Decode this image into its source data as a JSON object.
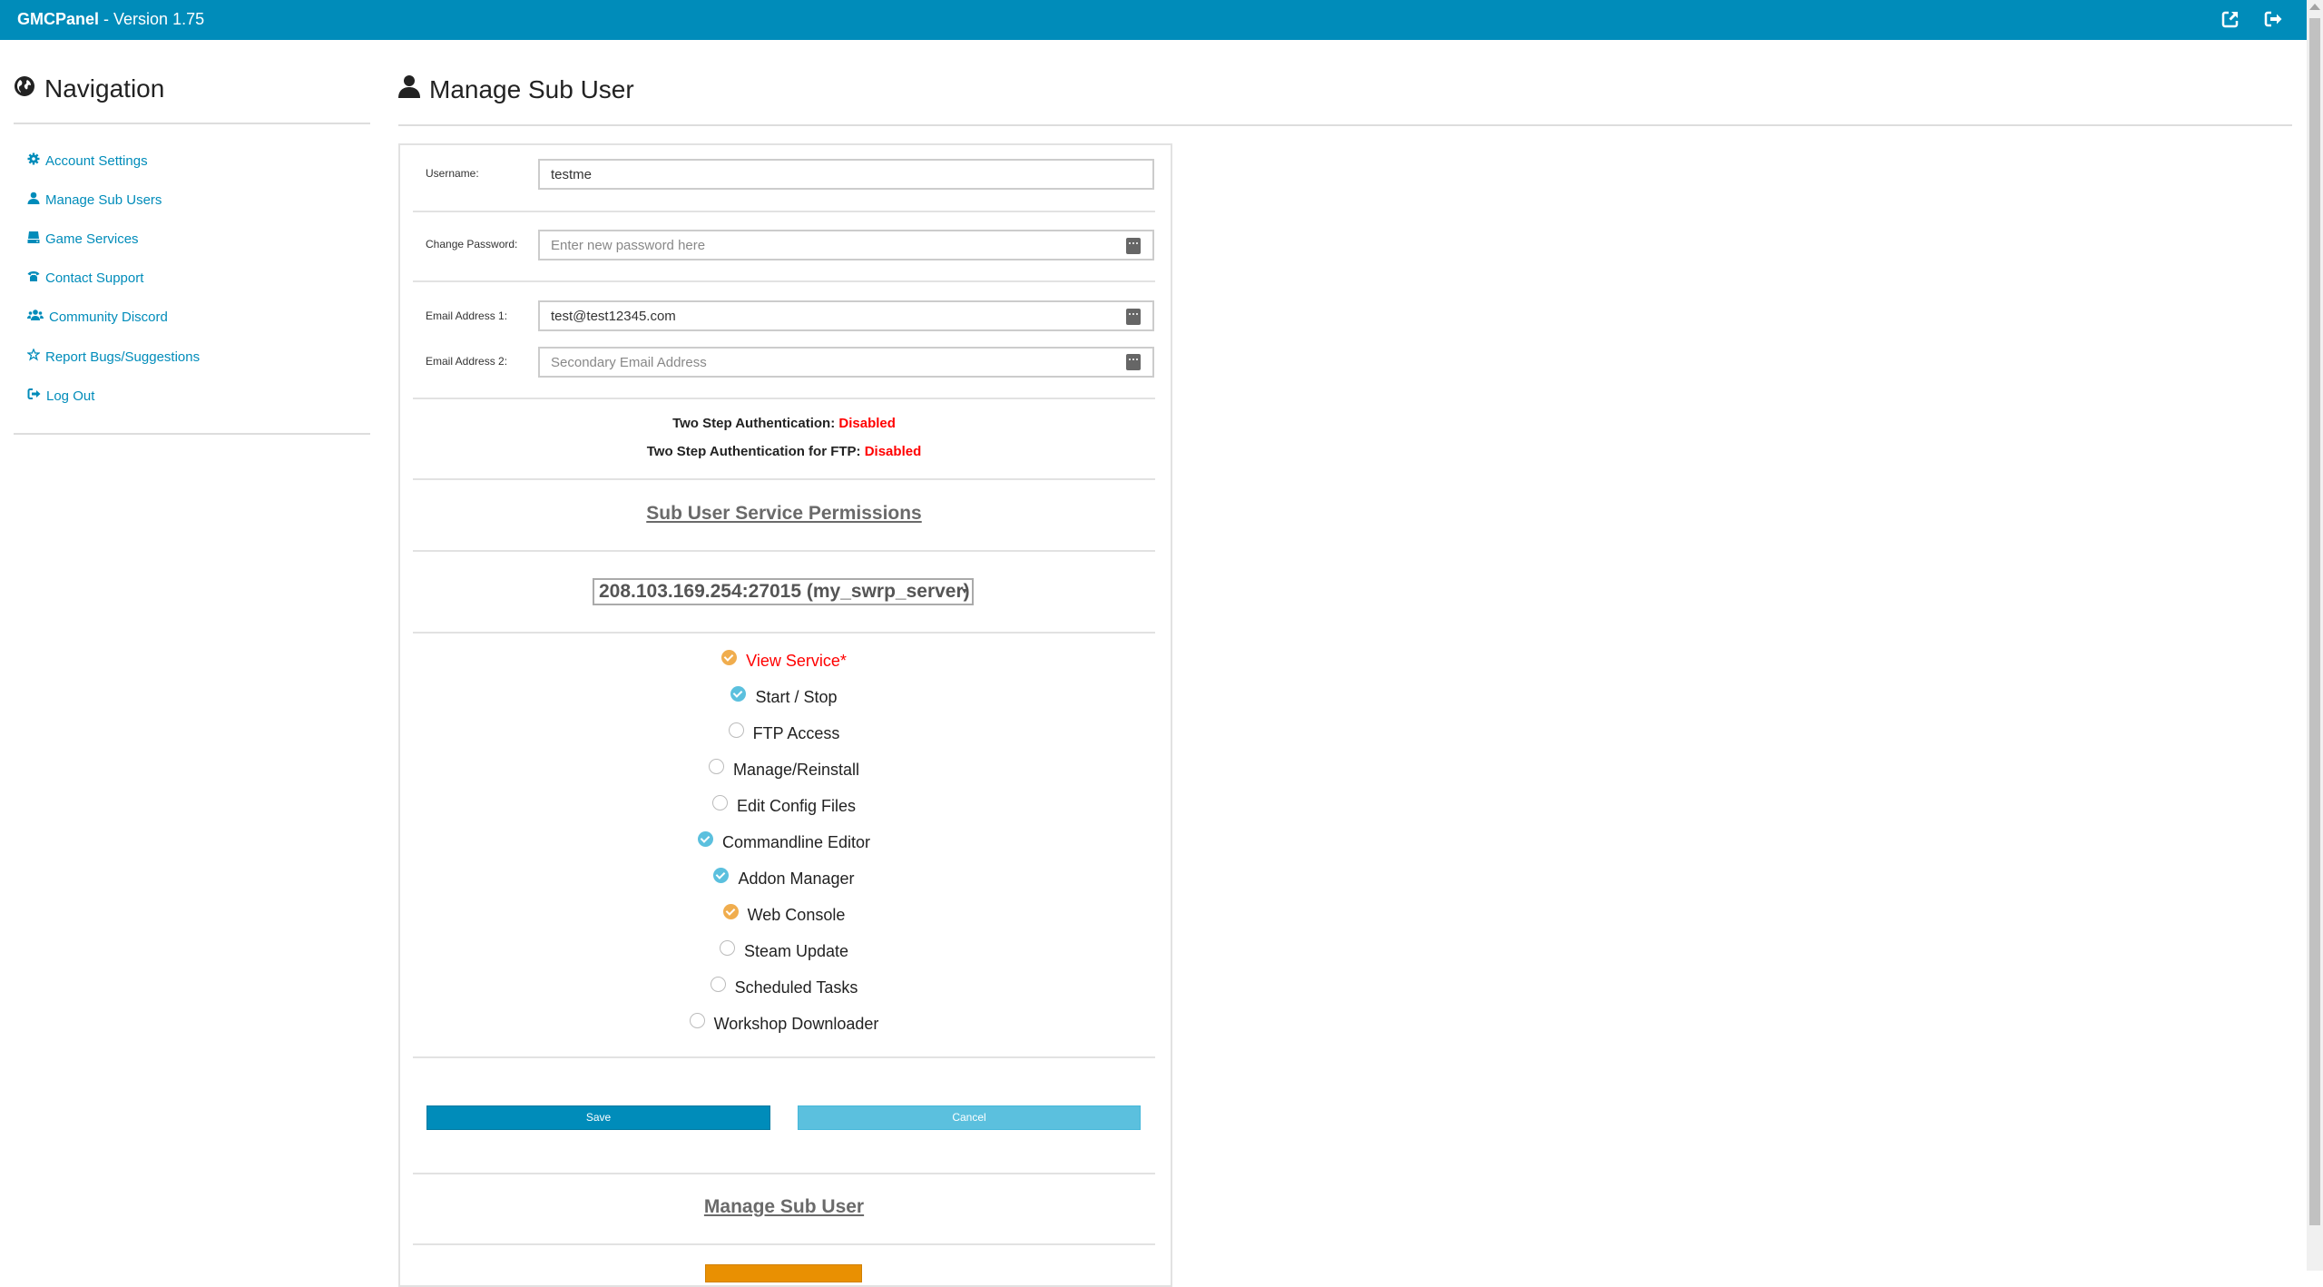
{
  "header": {
    "brand": "GMCPanel",
    "version": " - Version 1.75",
    "icons": [
      "external-link-icon",
      "sign-out-icon"
    ],
    "color": "#008cba"
  },
  "sidebar": {
    "title": "Navigation",
    "items": [
      {
        "label": "Account Settings",
        "icon": "gear-icon"
      },
      {
        "label": "Manage Sub Users",
        "icon": "user-icon"
      },
      {
        "label": "Game Services",
        "icon": "hdd-icon"
      },
      {
        "label": "Contact Support",
        "icon": "phone-icon"
      },
      {
        "label": "Community Discord",
        "icon": "users-icon"
      },
      {
        "label": "Report Bugs/Suggestions",
        "icon": "star-icon"
      },
      {
        "label": "Log Out",
        "icon": "sign-out-icon"
      }
    ]
  },
  "main": {
    "title": "Manage Sub User",
    "form": {
      "username_label": "Username:",
      "username_value": "testme",
      "password_label": "Change Password:",
      "password_placeholder": "Enter new password here",
      "email1_label": "Email Address 1:",
      "email1_value": "test@test12345.com",
      "email2_label": "Email Address 2:",
      "email2_placeholder": "Secondary Email Address"
    },
    "two_step": {
      "label": "Two Step Authentication: ",
      "status": "Disabled",
      "ftp_label": "Two Step Authentication for FTP: ",
      "ftp_status": "Disabled"
    },
    "permissions_title": "Sub User Service Permissions",
    "service_select": "208.103.169.254:27015 (my_swrp_server)",
    "permissions": [
      {
        "label": "View Service*",
        "checked": true,
        "style": "orange",
        "required": true
      },
      {
        "label": "Start / Stop",
        "checked": true,
        "style": "blue"
      },
      {
        "label": "FTP Access",
        "checked": false
      },
      {
        "label": "Manage/Reinstall",
        "checked": false
      },
      {
        "label": "Edit Config Files",
        "checked": false
      },
      {
        "label": "Commandline Editor",
        "checked": true,
        "style": "blue"
      },
      {
        "label": "Addon Manager",
        "checked": true,
        "style": "blue"
      },
      {
        "label": "Web Console",
        "checked": true,
        "style": "orange"
      },
      {
        "label": "Steam Update",
        "checked": false
      },
      {
        "label": "Scheduled Tasks",
        "checked": false
      },
      {
        "label": "Workshop Downloader",
        "checked": false
      }
    ],
    "save_label": "Save",
    "cancel_label": "Cancel",
    "manage_title": "Manage Sub User"
  }
}
